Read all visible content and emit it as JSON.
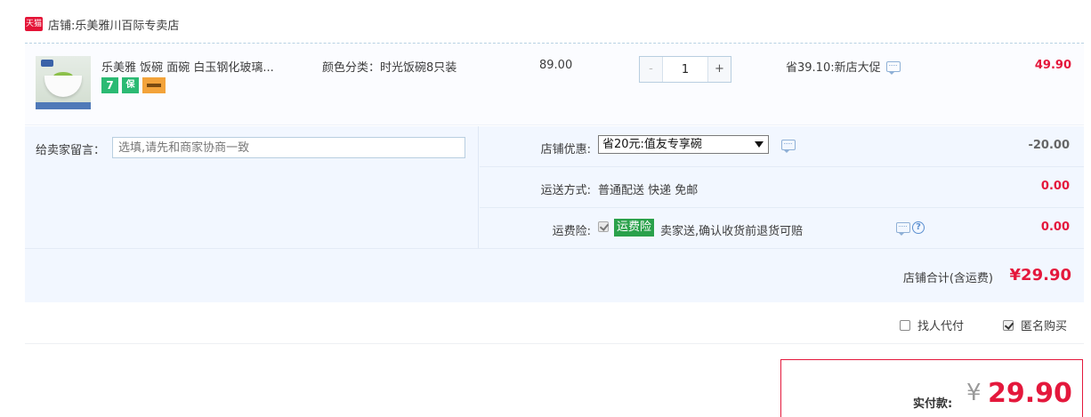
{
  "shop": {
    "badge": "天猫",
    "label": "店铺:",
    "name": "乐美雅川百际专卖店"
  },
  "item": {
    "title": "乐美雅 饭碗 面碗 白玉钢化玻璃...",
    "attr": "颜色分类：时光饭碗8只装",
    "service_badges": [
      "7",
      "保",
      "card"
    ],
    "price": "89.00",
    "quantity": "1",
    "minus": "-",
    "plus": "+",
    "promo": "省39.10:新店大促",
    "subtotal": "49.90"
  },
  "message": {
    "label": "给卖家留言：",
    "placeholder": "选填,请先和商家协商一致"
  },
  "options": {
    "coupon_label": "店铺优惠:",
    "coupon_value": "省20元:值友专享碗",
    "coupon_amount": "-20.00",
    "shipping_label": "运送方式:",
    "shipping_value": "普通配送 快递 免邮",
    "shipping_amount": "0.00",
    "insurance_label": "运费险:",
    "insurance_badge": "运费险",
    "insurance_text": "卖家送,确认收货前退货可赔",
    "insurance_amount": "0.00",
    "help": "?"
  },
  "total": {
    "label": "店铺合计(含运费)",
    "amount": "¥29.90"
  },
  "extras": {
    "proxy_pay": "找人代付",
    "anonymous": "匿名购买"
  },
  "pay": {
    "label": "实付款:",
    "yen": "¥",
    "amount": "29.90"
  },
  "colors": {
    "accent_red": "#e4183c",
    "insurance_green": "#2aa14b",
    "panel_blue": "#f2f7ff"
  }
}
